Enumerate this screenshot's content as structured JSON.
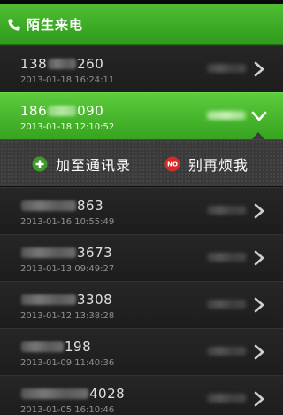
{
  "header": {
    "title": "陌生来电",
    "icon": "phone-icon"
  },
  "actions": {
    "add_to_contacts": "加至通讯录",
    "do_not_disturb": "别再烦我",
    "do_not_disturb_badge": "NO"
  },
  "calls": [
    {
      "number_start": "138",
      "number_end": "260",
      "time": "2013-01-18 16:24:11"
    },
    {
      "number_start": "186",
      "number_end": "090",
      "time": "2013-01-18 12:10:52"
    },
    {
      "number_start": "",
      "number_end": "863",
      "time": "2013-01-16 10:55:49"
    },
    {
      "number_start": "",
      "number_end": "3673",
      "time": "2013-01-13 09:49:27"
    },
    {
      "number_start": "",
      "number_end": "3308",
      "time": "2013-01-12 13:38:28"
    },
    {
      "number_start": "",
      "number_end": "198",
      "time": "2013-01-09 11:40:36"
    },
    {
      "number_start": "",
      "number_end": "4028",
      "time": "2013-01-05 16:10:46"
    }
  ],
  "colors": {
    "accent": "#3fb027",
    "header": "#3cae25",
    "background": "#1b1b1b"
  }
}
